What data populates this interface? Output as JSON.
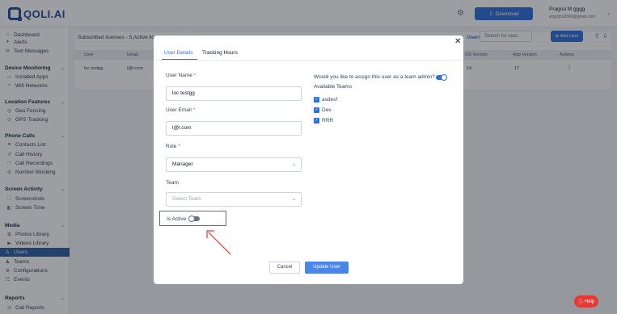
{
  "app": {
    "logo_text": "QOLI.AI"
  },
  "topbar": {
    "download_label": "Download",
    "user_name": "Pragna M gggg",
    "user_email": "enprgna2000@gmail.com"
  },
  "sidebar": {
    "items": [
      {
        "label": "Dashboard",
        "icon": "home-icon"
      },
      {
        "label": "Alerts",
        "icon": "bell-icon"
      },
      {
        "label": "Text Messages",
        "icon": "message-icon"
      },
      {
        "label": "Device Monitoring",
        "heading": true
      },
      {
        "label": "Installed Apps",
        "icon": "apps-icon"
      },
      {
        "label": "Wifi Networks",
        "icon": "wifi-icon"
      },
      {
        "label": "Location Features",
        "heading": true
      },
      {
        "label": "Geo Fencing",
        "icon": "pin-icon"
      },
      {
        "label": "GPS Tracking",
        "icon": "gps-icon"
      },
      {
        "label": "Phone Calls",
        "heading": true
      },
      {
        "label": "Contacts List",
        "icon": "contacts-icon"
      },
      {
        "label": "Call History",
        "icon": "history-icon"
      },
      {
        "label": "Call Recordings",
        "icon": "recording-icon"
      },
      {
        "label": "Number Blocking",
        "icon": "block-icon"
      },
      {
        "label": "Screen Activity",
        "heading": true
      },
      {
        "label": "Screenshots",
        "icon": "screenshot-icon"
      },
      {
        "label": "Screen Time",
        "icon": "screen-time-icon"
      },
      {
        "label": "Media",
        "heading": true
      },
      {
        "label": "Photos Library",
        "icon": "photo-icon"
      },
      {
        "label": "Videos Library",
        "icon": "video-icon"
      },
      {
        "label": "Users",
        "icon": "users-icon",
        "active": true
      },
      {
        "label": "Teams",
        "icon": "teams-icon"
      },
      {
        "label": "Configurations",
        "icon": "config-icon"
      },
      {
        "label": "Events",
        "icon": "events-icon"
      },
      {
        "label": "Reports",
        "heading": true
      },
      {
        "label": "Call Reports",
        "icon": "report-icon"
      }
    ]
  },
  "main": {
    "subscribed_text": "Subscribed licenses - 5,Active lice",
    "users_label": "Users",
    "search_placeholder": "Search for user...",
    "add_user_label": "Add User",
    "columns": [
      "User",
      "Email",
      "OS Version",
      "App Version",
      "Actions"
    ],
    "row": {
      "user": "loc testgg",
      "email": "l@l.com",
      "os_version": "14",
      "app_version": "17"
    }
  },
  "modal": {
    "tabs": [
      "User Details",
      "Tracking Hours"
    ],
    "user_name_label": "User Name",
    "user_name_value": "loc testgg",
    "user_email_label": "User Email",
    "user_email_value": "l@l.com",
    "role_label": "Role",
    "role_value": "Manager",
    "team_label": "Team",
    "team_placeholder": "Select Team",
    "is_active_label": "Is Active",
    "is_active": false,
    "team_admin_question": "Would you like to assign this user as a team admin?",
    "team_admin": true,
    "available_teams_label": "Available Teams",
    "teams": [
      "asdesf",
      "Dev",
      "RRR"
    ],
    "cancel_label": "Cancel",
    "update_label": "Update User"
  },
  "help_label": "Help",
  "colors": {
    "accent": "#2f6fdd",
    "sidebar_active": "#2f5fa8",
    "highlight": "#e0393b",
    "help": "#e53935"
  }
}
